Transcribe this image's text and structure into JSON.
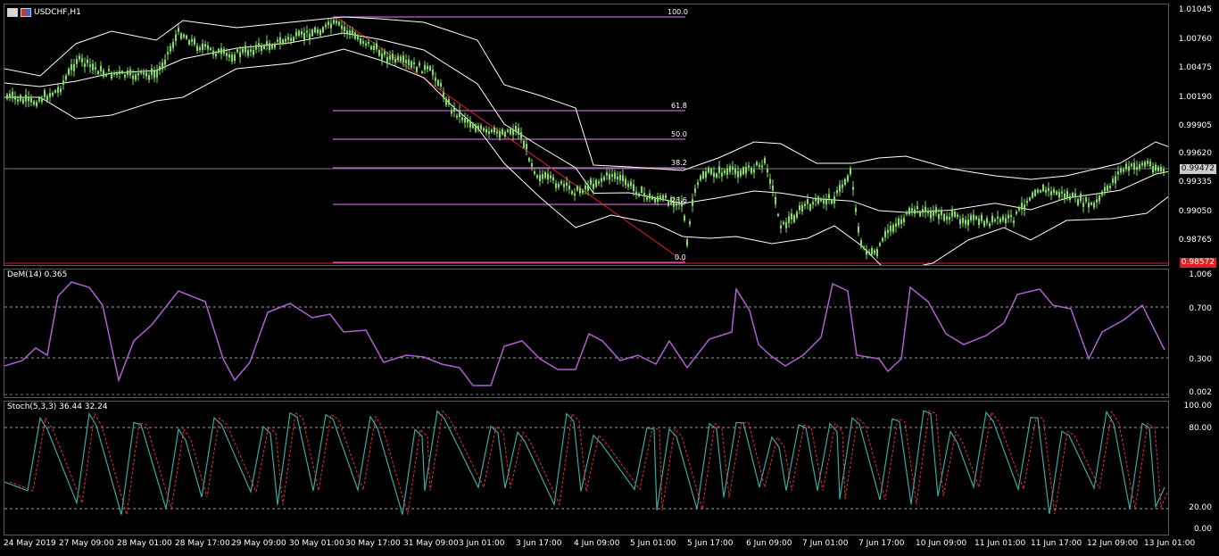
{
  "window": {
    "symbol_label": "USDCHF,H1"
  },
  "price_axis": [
    "1.01045",
    "1.00760",
    "1.00475",
    "1.00190",
    "0.99905",
    "0.99620",
    "0.99335",
    "0.99050",
    "0.98765"
  ],
  "current_price_tag": "0.99472",
  "red_line_tag": "0.98572",
  "fibonacci": {
    "levels": [
      "100.0",
      "61.8",
      "50.0",
      "38.2",
      "23.6",
      "0.0"
    ]
  },
  "dem": {
    "label": "DeM(14) 0.365",
    "axis": [
      "1.006",
      "0.700",
      "0.300",
      "0.002"
    ]
  },
  "stoch": {
    "label": "Stoch(5,3,3) 36.44 32.24",
    "axis": [
      "100.00",
      "80.00",
      "20.00",
      "0.00"
    ]
  },
  "time_axis": [
    "24 May 2019",
    "27 May 09:00",
    "28 May 01:00",
    "28 May 17:00",
    "29 May 09:00",
    "30 May 01:00",
    "30 May 17:00",
    "31 May 09:00",
    "3 Jun 01:00",
    "3 Jun 17:00",
    "4 Jun 09:00",
    "5 Jun 01:00",
    "5 Jun 17:00",
    "6 Jun 09:00",
    "7 Jun 01:00",
    "7 Jun 17:00",
    "10 Jun 09:00",
    "11 Jun 01:00",
    "11 Jun 17:00",
    "12 Jun 09:00",
    "13 Jun 01:00"
  ],
  "colors": {
    "candle": "#7fe05a",
    "bands": "#ffffff",
    "fib": "#c060d0",
    "dem": "#b060d0",
    "stoch_main": "#3aa9a0",
    "stoch_signal": "#e03030",
    "red_line": "#e02020"
  }
}
